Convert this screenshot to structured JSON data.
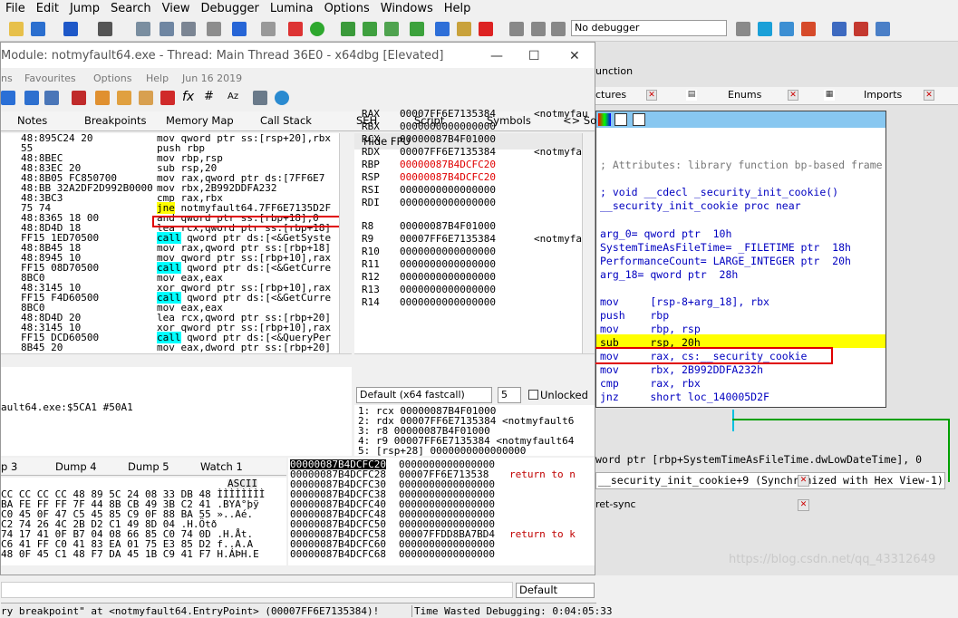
{
  "ida": {
    "menu": [
      "File",
      "Edit",
      "Jump",
      "Search",
      "View",
      "Debugger",
      "Lumina",
      "Options",
      "Windows",
      "Help"
    ],
    "debugger_select": "No debugger",
    "function_label": "unction",
    "tabs": [
      {
        "label": "ctures"
      },
      {
        "label": "Enums"
      },
      {
        "label": "Imports"
      }
    ],
    "view_lines": [
      {
        "text": "; Attributes: library function bp-based frame",
        "cls": "ida-cmt"
      },
      {
        "text": "; void __cdecl _security_init_cookie()",
        "cls": ""
      },
      {
        "text": "__security_init_cookie proc near",
        "cls": ""
      },
      {
        "text": "arg_0= qword ptr  10h",
        "cls": ""
      },
      {
        "text": "SystemTimeAsFileTime= _FILETIME ptr  18h",
        "cls": ""
      },
      {
        "text": "PerformanceCount= LARGE_INTEGER ptr  20h",
        "cls": ""
      },
      {
        "text": "arg_18= qword ptr  28h",
        "cls": ""
      },
      {
        "text": "mov     [rsp-8+arg_18], rbx",
        "cls": ""
      },
      {
        "text": "push    rbp",
        "cls": ""
      },
      {
        "text": "mov     rbp, rsp",
        "cls": ""
      },
      {
        "text": "sub     rsp, 20h",
        "cls": "ida-blk"
      },
      {
        "text": "mov     rax, cs:__security_cookie",
        "cls": ""
      },
      {
        "text": "mov     rbx, 2B992DDFA232h",
        "cls": ""
      },
      {
        "text": "cmp     rax, rbx",
        "cls": ""
      },
      {
        "text": "jnz     short loc_140005D2F",
        "cls": ""
      }
    ],
    "line_below": "word ptr [rbp+SystemTimeAsFileTime.dwLowDateTime], 0",
    "sync_text": "__security_init_cookie+9 (Synchronized with Hex View-1)",
    "ret_label": "ret-sync",
    "watermark": "https://blog.csdn.net/qq_43312649"
  },
  "xdbg": {
    "title": "Module: notmyfault64.exe - Thread: Main Thread 36E0 - x64dbg [Elevated]",
    "menu": [
      "ns",
      "Favourites",
      "Options",
      "Help",
      "Jun 16 2019"
    ],
    "tabs": [
      "Notes",
      "Breakpoints",
      "Memory Map",
      "Call Stack",
      "SEH",
      "Script",
      "Symbols",
      "<> So"
    ],
    "cpu_rows": [
      {
        "b": "48:895C24 20",
        "i": "mov qword ptr ss:[rsp+20],rbx",
        "t": ""
      },
      {
        "b": "55",
        "i": "push rbp",
        "t": ""
      },
      {
        "b": "48:8BEC",
        "i": "mov rbp,rsp",
        "t": ""
      },
      {
        "b": "48:83EC 20",
        "i": "sub rsp,20",
        "t": ""
      },
      {
        "b": "48:8B05 FC850700",
        "i": "mov rax,qword ptr ds:[7FF6E7",
        "t": ""
      },
      {
        "b": "48:BB 32A2DF2D992B0000",
        "i": "mov rbx,2B992DDFA232",
        "t": ""
      },
      {
        "b": "48:3BC3",
        "i": "cmp rax,rbx",
        "t": ""
      },
      {
        "b": "75 74",
        "i": "jne notmyfault64.7FF6E7135D2F",
        "t": "jmp"
      },
      {
        "b": "48:8365 18 00",
        "i": "and qword ptr ss:[rbp+18],0",
        "t": ""
      },
      {
        "b": "48:8D4D 18",
        "i": "lea rcx,qword ptr ss:[rbp+18]",
        "t": ""
      },
      {
        "b": "FF15 1ED70500",
        "i": "call qword ptr ds:[<&GetSyste",
        "t": "call"
      },
      {
        "b": "48:8B45 18",
        "i": "mov rax,qword ptr ss:[rbp+18]",
        "t": ""
      },
      {
        "b": "48:8945 10",
        "i": "mov qword ptr ss:[rbp+10],rax",
        "t": ""
      },
      {
        "b": "FF15 08D70500",
        "i": "call qword ptr ds:[<&GetCurre",
        "t": "call"
      },
      {
        "b": "8BC0",
        "i": "mov eax,eax",
        "t": ""
      },
      {
        "b": "48:3145 10",
        "i": "xor qword ptr ss:[rbp+10],rax",
        "t": ""
      },
      {
        "b": "FF15 F4D60500",
        "i": "call qword ptr ds:[<&GetCurre",
        "t": "call"
      },
      {
        "b": "8BC0",
        "i": "mov eax,eax",
        "t": ""
      },
      {
        "b": "48:8D4D 20",
        "i": "lea rcx,qword ptr ss:[rbp+20]",
        "t": ""
      },
      {
        "b": "48:3145 10",
        "i": "xor qword ptr ss:[rbp+10],rax",
        "t": ""
      },
      {
        "b": "FF15 DCD60500",
        "i": "call qword ptr ds:[<&QueryPer",
        "t": "call"
      },
      {
        "b": "8B45 20",
        "i": "mov eax,dword ptr ss:[rbp+20]",
        "t": ""
      }
    ],
    "hide_fpu": "Hide FPU",
    "registers": [
      {
        "n": "RAX",
        "v": "00007FF6E7135384",
        "c": "<notmyfau",
        "red": false
      },
      {
        "n": "RBX",
        "v": "0000000000000000",
        "c": "",
        "red": false
      },
      {
        "n": "RCX",
        "v": "00000087B4F01000",
        "c": "",
        "red": false
      },
      {
        "n": "RDX",
        "v": "00007FF6E7135384",
        "c": "<notmyfau",
        "red": false
      },
      {
        "n": "RBP",
        "v": "00000087B4DCFC20",
        "c": "",
        "red": true
      },
      {
        "n": "RSP",
        "v": "00000087B4DCFC20",
        "c": "",
        "red": true
      },
      {
        "n": "RSI",
        "v": "0000000000000000",
        "c": "",
        "red": false
      },
      {
        "n": "RDI",
        "v": "0000000000000000",
        "c": "",
        "red": false
      },
      {
        "n": "R8",
        "v": "00000087B4F01000",
        "c": "",
        "red": false
      },
      {
        "n": "R9",
        "v": "00007FF6E7135384",
        "c": "<notmyfau",
        "red": false
      },
      {
        "n": "R10",
        "v": "0000000000000000",
        "c": "",
        "red": false
      },
      {
        "n": "R11",
        "v": "0000000000000000",
        "c": "",
        "red": false
      },
      {
        "n": "R12",
        "v": "0000000000000000",
        "c": "",
        "red": false
      },
      {
        "n": "R13",
        "v": "0000000000000000",
        "c": "",
        "red": false
      },
      {
        "n": "R14",
        "v": "0000000000000000",
        "c": "",
        "red": false
      }
    ],
    "callconv": "Default (x64 fastcall)",
    "callnum": "5",
    "unlocked": "Unlocked",
    "args": [
      "1: rcx 00000087B4F01000",
      "2: rdx 00007FF6E7135384 <notmyfault6",
      "3: r8 00000087B4F01000",
      "4: r9 00007FF6E7135384 <notmyfault64",
      "5: [rsp+28] 0000000000000000"
    ],
    "info_line": "ault64.exe:$5CA1 #50A1",
    "dump_tabs": [
      "p 3",
      "Dump 4",
      "Dump 5",
      "Watch 1"
    ],
    "dump_ascii_head": "ASCII",
    "dump_rows": [
      "CC CC CC CC 48 89 5C 24 08 33 DB 48 ÌÌÌÌÌÌÌÌ",
      "BA FE FF FF 7F 44 8B CB 49 3B C2 41 .BYA°þÿ",
      "C0 45 0F 47 C5 45 85 C9 0F 88 BA 55 »..Aé.",
      "C2 74 26 4C 2B D2 C1 49 8D 04 .H.Ötð",
      "74 17 41 0F B7 04 08 66 85 C0 74 0D .H.Åt.",
      "C6 41 FF C0 41 83 EA 01 75 E3 85 D2 f..A.A",
      "48 0F 45 C1 48 F7 DA 45 1B C9 41 F7 H.ÁÞH.E"
    ],
    "stack_rows": [
      {
        "a": "00000087B4DCFC20",
        "v": "0000000000000000",
        "c": "",
        "sel": true
      },
      {
        "a": "00000087B4DCFC28",
        "v": "00007FF6E713538",
        "c": "return to n",
        "sel": false
      },
      {
        "a": "00000087B4DCFC30",
        "v": "0000000000000000",
        "c": "",
        "sel": false
      },
      {
        "a": "00000087B4DCFC38",
        "v": "0000000000000000",
        "c": "",
        "sel": false
      },
      {
        "a": "00000087B4DCFC40",
        "v": "0000000000000000",
        "c": "",
        "sel": false
      },
      {
        "a": "00000087B4DCFC48",
        "v": "0000000000000000",
        "c": "",
        "sel": false
      },
      {
        "a": "00000087B4DCFC50",
        "v": "0000000000000000",
        "c": "",
        "sel": false
      },
      {
        "a": "00000087B4DCFC58",
        "v": "00007FFDD8BA7BD4",
        "c": "return to k",
        "sel": false
      },
      {
        "a": "00000087B4DCFC60",
        "v": "0000000000000000",
        "c": "",
        "sel": false
      },
      {
        "a": "00000087B4DCFC68",
        "v": "0000000000000000",
        "c": "",
        "sel": false
      }
    ],
    "default_label": "Default",
    "status_msg": "ry breakpoint\" at <notmyfault64.EntryPoint> (00007FF6E7135384)!",
    "status_time": "Time Wasted Debugging: 0:04:05:33"
  }
}
